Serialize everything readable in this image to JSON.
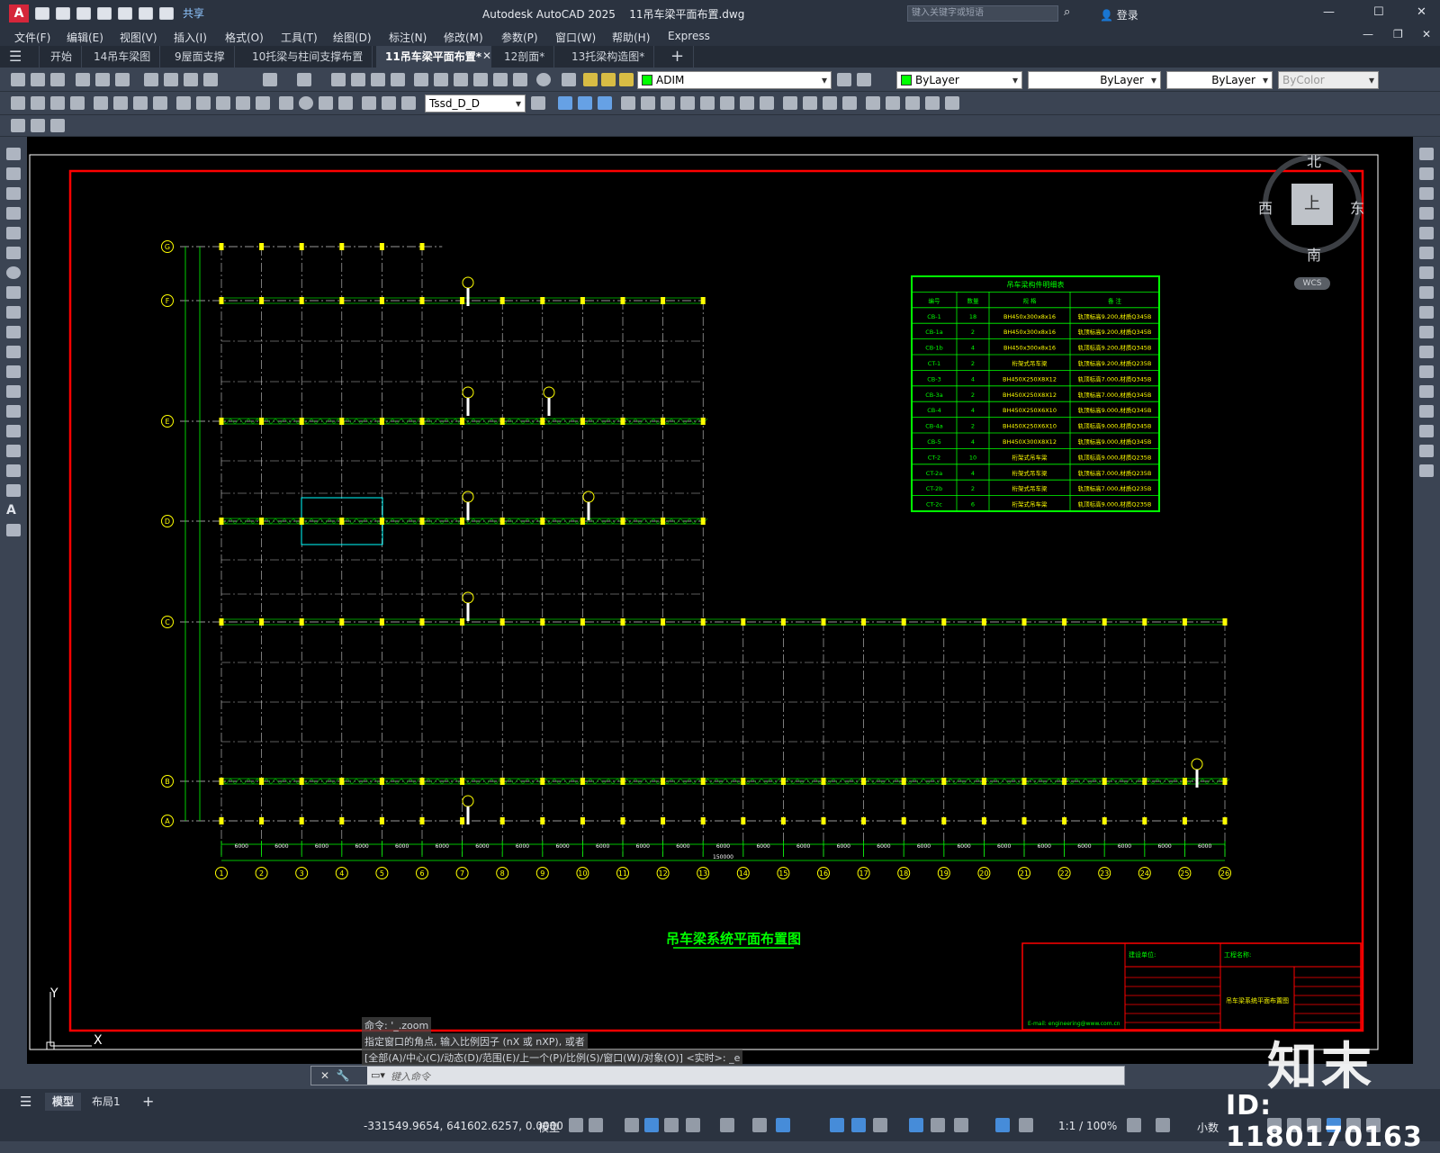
{
  "app": {
    "logo_letter": "A",
    "share_label": "共享",
    "title": "Autodesk AutoCAD 2025",
    "filename": "11吊车梁平面布置.dwg",
    "search_placeholder": "键入关键字或短语",
    "login_label": "登录"
  },
  "menu": [
    "文件(F)",
    "编辑(E)",
    "视图(V)",
    "插入(I)",
    "格式(O)",
    "工具(T)",
    "绘图(D)",
    "标注(N)",
    "修改(M)",
    "参数(P)",
    "窗口(W)",
    "帮助(H)",
    "Express"
  ],
  "tabs": [
    {
      "label": "开始",
      "active": false
    },
    {
      "label": "14吊车梁图",
      "active": false
    },
    {
      "label": "9屋面支撑",
      "active": false
    },
    {
      "label": "10托梁与柱间支撑布置",
      "active": false
    },
    {
      "label": "11吊车梁平面布置*",
      "active": true
    },
    {
      "label": "12剖面*",
      "active": false
    },
    {
      "label": "13托梁构造图*",
      "active": false
    }
  ],
  "toolbar": {
    "layer_name": "ADIM",
    "color": "ByLayer",
    "linetype": "ByLayer",
    "lineweight": "ByLayer",
    "plotstyle": "ByColor",
    "dimstyle": "Tssd_D_D"
  },
  "viewcube": {
    "north": "北",
    "south": "南",
    "east": "东",
    "west": "西",
    "top": "上",
    "wcs": "WCS"
  },
  "drawing": {
    "title": "吊车梁系统平面布置图",
    "grid_numbers": [
      "1",
      "2",
      "3",
      "4",
      "5",
      "6",
      "7",
      "8",
      "9",
      "10",
      "11",
      "12",
      "13",
      "14",
      "15",
      "16",
      "17",
      "18",
      "19",
      "20",
      "21",
      "22",
      "23",
      "24",
      "25",
      "26"
    ],
    "bay_label": "6000",
    "total_label": "150000",
    "axis_letters": [
      "G",
      "F",
      "E",
      "D",
      "C",
      "B",
      "A"
    ],
    "table": {
      "title": "吊车梁构件明细表",
      "headers": [
        "编号",
        "数量",
        "规 格",
        "备 注"
      ],
      "rows": [
        [
          "CB-1",
          "18",
          "BH450x300x8x16",
          "轨顶标高9.200,材质Q345B"
        ],
        [
          "CB-1a",
          "2",
          "BH450x300x8x16",
          "轨顶标高9.200,材质Q345B"
        ],
        [
          "CB-1b",
          "4",
          "BH450x300x8x16",
          "轨顶标高9.200,材质Q345B"
        ],
        [
          "CT-1",
          "2",
          "桁架式吊车梁",
          "轨顶标高9.200,材质Q235B"
        ],
        [
          "CB-3",
          "4",
          "BH450X250X8X12",
          "轨顶标高7.000,材质Q345B"
        ],
        [
          "CB-3a",
          "2",
          "BH450X250X8X12",
          "轨顶标高7.000,材质Q345B"
        ],
        [
          "CB-4",
          "4",
          "BH450X250X6X10",
          "轨顶标高9.000,材质Q345B"
        ],
        [
          "CB-4a",
          "2",
          "BH450X250X6X10",
          "轨顶标高9.000,材质Q345B"
        ],
        [
          "CB-5",
          "4",
          "BH450X300X8X12",
          "轨顶标高9.000,材质Q345B"
        ],
        [
          "CT-2",
          "10",
          "桁架式吊车梁",
          "轨顶标高9.000,材质Q235B"
        ],
        [
          "CT-2a",
          "4",
          "桁架式吊车梁",
          "轨顶标高7.000,材质Q235B"
        ],
        [
          "CT-2b",
          "2",
          "桁架式吊车梁",
          "轨顶标高7.000,材质Q235B"
        ],
        [
          "CT-2c",
          "6",
          "桁架式吊车梁",
          "轨顶标高9.000,材质Q235B"
        ]
      ]
    },
    "titleblock": {
      "designer_unit": "建设单位:",
      "project_name": "工程名称:",
      "drawing_name": "吊车梁系统平面布置图",
      "email": "E-mail: engineering@www.com.cn"
    }
  },
  "command": {
    "line1": "命令: '_.zoom",
    "line2": "指定窗口的角点, 输入比例因子 (nX 或 nXP), 或者",
    "line3": "[全部(A)/中心(C)/动态(D)/范围(E)/上一个(P)/比例(S)/窗口(W)/对象(O)] <实时>: _e",
    "placeholder": "键入命令"
  },
  "layouts": [
    {
      "label": "模型",
      "active": true
    },
    {
      "label": "布局1",
      "active": false
    }
  ],
  "status": {
    "coords": "-331549.9654, 641602.6257, 0.0000",
    "space": "模型",
    "scale": "1:1 / 100%",
    "units": "小数"
  },
  "watermark": {
    "id": "ID: 1180170163",
    "brand": "知末"
  }
}
